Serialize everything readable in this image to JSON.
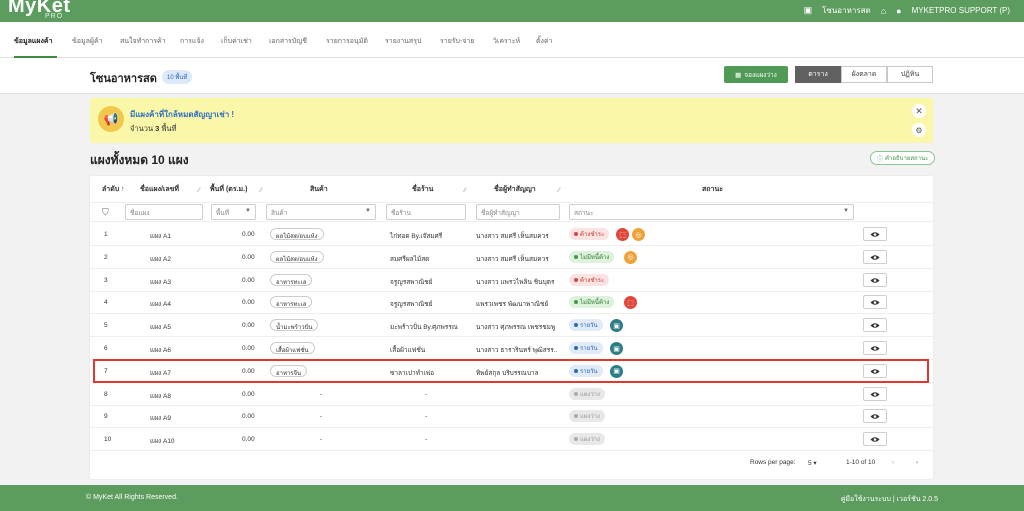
{
  "app": {
    "logo": "MyKet",
    "logo_sub": "PRO"
  },
  "topbar": {
    "zone": "โซนอาหารสด",
    "user": "MYKETPRO SUPPORT (P)"
  },
  "nav": [
    "ข้อมูลแผงค้า",
    "ข้อมูลผู้ค้า",
    "สนใจทำการค้า",
    "การแจ้ง",
    "เก็บค่าเช่า",
    "เอกสารบัญชี",
    "รายการอนุมัติ",
    "รายงานสรุป",
    "รายรับ-จ่าย",
    "วิเคราะห์",
    "ตั้งค่า"
  ],
  "header": {
    "title": "โซนอาหารสด",
    "badge": "10 พื้นที่",
    "rent_button": "จองแผงว่าง",
    "views": [
      "ตาราง",
      "ผังตลาด",
      "ปฏิทิน"
    ]
  },
  "banner": {
    "title": "มีแผงค้าที่ใกล้หมดสัญญาเช่า !",
    "subtitle_prefix": "จำนวน",
    "count": "3",
    "subtitle_suffix": "พื้นที่"
  },
  "section": {
    "title": "แผงทั้งหมด 10 แผง",
    "description_button": "คำอธิบายสถานะ"
  },
  "table": {
    "headers": [
      "ลำดับ ↑",
      "ชื่อแผง/เลขที่",
      "พื้นที่ (ตร.ม.)",
      "สินค้า",
      "ชื่อร้าน",
      "ชื่อผู้ทำสัญญา",
      "สถานะ"
    ],
    "filters": {
      "stall": "ชื่อแผง",
      "area": "พื้นที่",
      "product": "สินค้า",
      "shop": "ชื่อร้าน",
      "owner": "ชื่อผู้ทำสัญญา",
      "status": "สถานะ"
    },
    "rows": [
      {
        "no": "1",
        "stall": "แผง A1",
        "area": "0.00",
        "product": "ผลไม้สด/อบแห้ง",
        "shop": "ไก่ทอด By.เจ๊สมศรี",
        "owner": "นางสาว สมศรี เห็นสมควร",
        "status": "ค้างชำระ",
        "status_type": "overdue",
        "icons": [
          "red",
          "orange"
        ]
      },
      {
        "no": "2",
        "stall": "แผง A2",
        "area": "0.00",
        "product": "ผลไม้สด/อบแห้ง",
        "shop": "สมศรีผลไม้สด",
        "owner": "นางสาว สมศรี เห็นสมควร",
        "status": "ไม่มีหนี้ค้าง",
        "status_type": "clear",
        "icons": [
          "orange"
        ]
      },
      {
        "no": "3",
        "stall": "แผง A3",
        "area": "0.00",
        "product": "อาหารทะเล",
        "shop": "จรูญรสพาณิชย์",
        "owner": "นางสาว แพรวไพลิน ชินบุตร",
        "status": "ค้างชำระ",
        "status_type": "overdue",
        "icons": []
      },
      {
        "no": "4",
        "stall": "แผง A4",
        "area": "0.00",
        "product": "อาหารทะเล",
        "shop": "จรูญรสพาณิชย์",
        "owner": "แพรวเพชร พัฒนาพาณิชย์",
        "status": "ไม่มีหนี้ค้าง",
        "status_type": "clear",
        "icons": [
          "red"
        ]
      },
      {
        "no": "5",
        "stall": "แผง A5",
        "area": "0.00",
        "product": "น้ำมะพร้าวปั่น",
        "shop": "มะพร้าวปั่น By.ศุภพรรณ",
        "owner": "นางสาว ศุภพรรณ เพชรชมพู",
        "status": "รายวัน",
        "status_type": "daily",
        "icons": [
          "teal"
        ]
      },
      {
        "no": "6",
        "stall": "แผง A6",
        "area": "0.00",
        "product": "เสื้อผ้าแฟชั่น",
        "shop": "เสื้อผ้าแฟชั่น",
        "owner": "นางสาว ธารารินทร์ พุฒิสรร..",
        "status": "รายวัน",
        "status_type": "daily",
        "icons": [
          "teal"
        ]
      },
      {
        "no": "7",
        "stall": "แผง A7",
        "area": "0.00",
        "product": "อาหารจีน",
        "shop": "ซาลาเปาทำเพ่อ",
        "owner": "ทิพย์สกุล บริบรรณบาล",
        "status": "รายวัน",
        "status_type": "daily",
        "icons": [
          "teal"
        ]
      },
      {
        "no": "8",
        "stall": "แผง A8",
        "area": "0.00",
        "product": "-",
        "shop": "-",
        "owner": "",
        "status": "แผงว่าง",
        "status_type": "vacant",
        "icons": []
      },
      {
        "no": "9",
        "stall": "แผง A9",
        "area": "0.00",
        "product": "-",
        "shop": "-",
        "owner": "",
        "status": "แผงว่าง",
        "status_type": "vacant",
        "icons": []
      },
      {
        "no": "10",
        "stall": "แผง A10",
        "area": "0.00",
        "product": "-",
        "shop": "-",
        "owner": "",
        "status": "แผงว่าง",
        "status_type": "vacant",
        "icons": []
      }
    ]
  },
  "pagination": {
    "rows_label": "Rows per page:",
    "rows_value": "5",
    "range": "1-10 of 10"
  },
  "footer": {
    "copyright": "© MyKet All Rights Reserved.",
    "right": "คู่มือใช้งานระบบ | เวอร์ชัน 2.0.5"
  },
  "colors": {
    "brand_green": "#5c9c5e",
    "highlight_red": "#e0382f",
    "banner_yellow": "#fbf7a8"
  }
}
